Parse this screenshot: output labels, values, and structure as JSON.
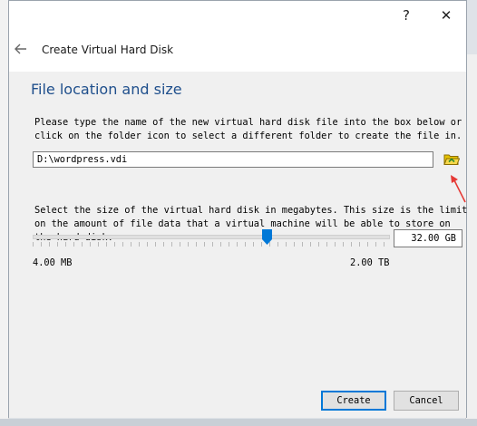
{
  "window": {
    "help_label": "?",
    "close_label": "✕"
  },
  "header": {
    "back_icon": "arrow-left-icon",
    "title": "Create Virtual Hard Disk"
  },
  "section": {
    "title": "File location and size",
    "location_description_line1": "Please type the name of the new virtual hard disk file into the box below or",
    "location_description_line2": "click on the folder icon to select a different folder to create the file in.",
    "file_path": "D:\\wordpress.vdi",
    "folder_icon": "folder-open-icon",
    "size_description_line1": "Select the size of the virtual hard disk in megabytes. This size is the limit",
    "size_description_line2": "on the amount of file data that a virtual machine will be able to store on",
    "size_description_line3": "the hard disk.",
    "size_value": "32.00 GB",
    "slider_fraction": 0.66,
    "range_min": "4.00 MB",
    "range_max": "2.00 TB"
  },
  "footer": {
    "create_label": "Create",
    "cancel_label": "Cancel"
  },
  "colors": {
    "accent": "#0078d7",
    "section_title": "#1f4f8c",
    "annotation_arrow": "#e53935",
    "folder": "#e6c200"
  }
}
